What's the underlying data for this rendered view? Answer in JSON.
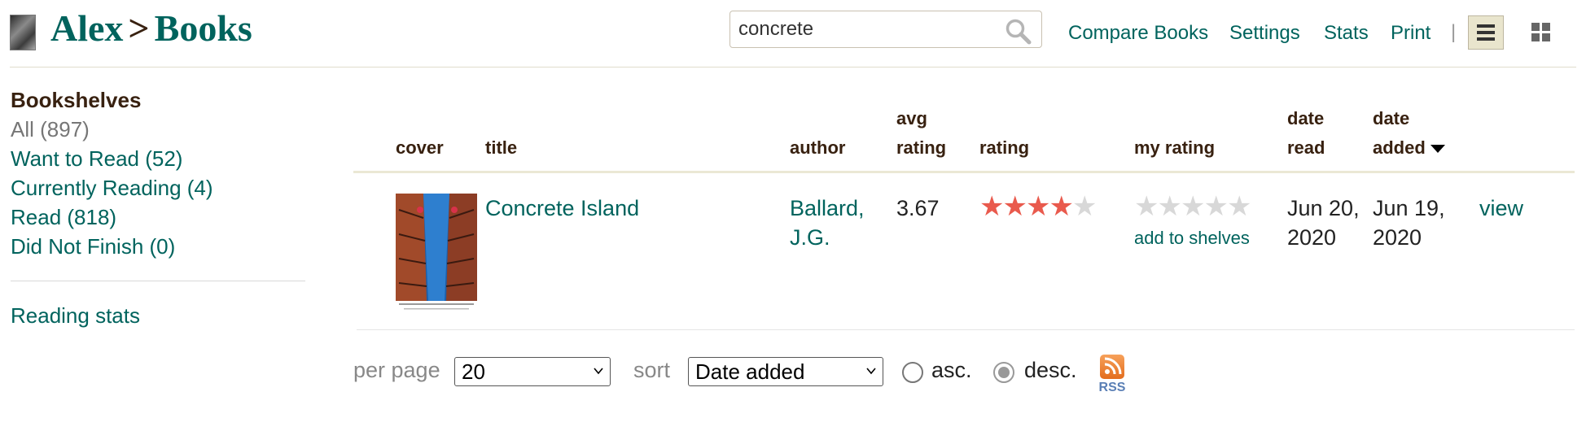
{
  "header": {
    "user": "Alex",
    "separator": ">",
    "section": "Books",
    "search": {
      "value": "concrete",
      "placeholder": ""
    },
    "links": [
      "Compare Books",
      "Settings",
      "Stats",
      "Print"
    ],
    "pipe": "|"
  },
  "sidebar": {
    "heading": "Bookshelves",
    "shelves": [
      {
        "label": "All (897)"
      },
      {
        "label": "Want to Read (52)"
      },
      {
        "label": "Currently Reading (4)"
      },
      {
        "label": "Read (818)"
      },
      {
        "label": "Did Not Finish (0)"
      }
    ],
    "reading_stats": "Reading stats"
  },
  "table": {
    "headers": {
      "cover": "cover",
      "title": "title",
      "author": "author",
      "avg_rating_1": "avg",
      "avg_rating_2": "rating",
      "rating": "rating",
      "my_rating": "my rating",
      "date_read_1": "date",
      "date_read_2": "read",
      "date_added_1": "date",
      "date_added_2": "added"
    },
    "rows": [
      {
        "title": "Concrete Island",
        "author_1": "Ballard,",
        "author_2": "J.G.",
        "avg_rating": "3.67",
        "rating_stars": 4,
        "my_rating_stars": 0,
        "add_to_shelves": "add to shelves",
        "date_read_1": "Jun 20,",
        "date_read_2": "2020",
        "date_added_1": "Jun 19,",
        "date_added_2": "2020",
        "view": "view"
      }
    ]
  },
  "footer": {
    "per_page_label": "per page",
    "per_page_value": "20",
    "sort_label": "sort",
    "sort_value": "Date added",
    "asc_label": "asc.",
    "desc_label": "desc.",
    "order_selected": "desc",
    "rss_label": "RSS"
  },
  "colors": {
    "link": "#00635d",
    "text": "#382110",
    "star_on": "#e95a4d",
    "star_off": "#d8d8d8"
  }
}
